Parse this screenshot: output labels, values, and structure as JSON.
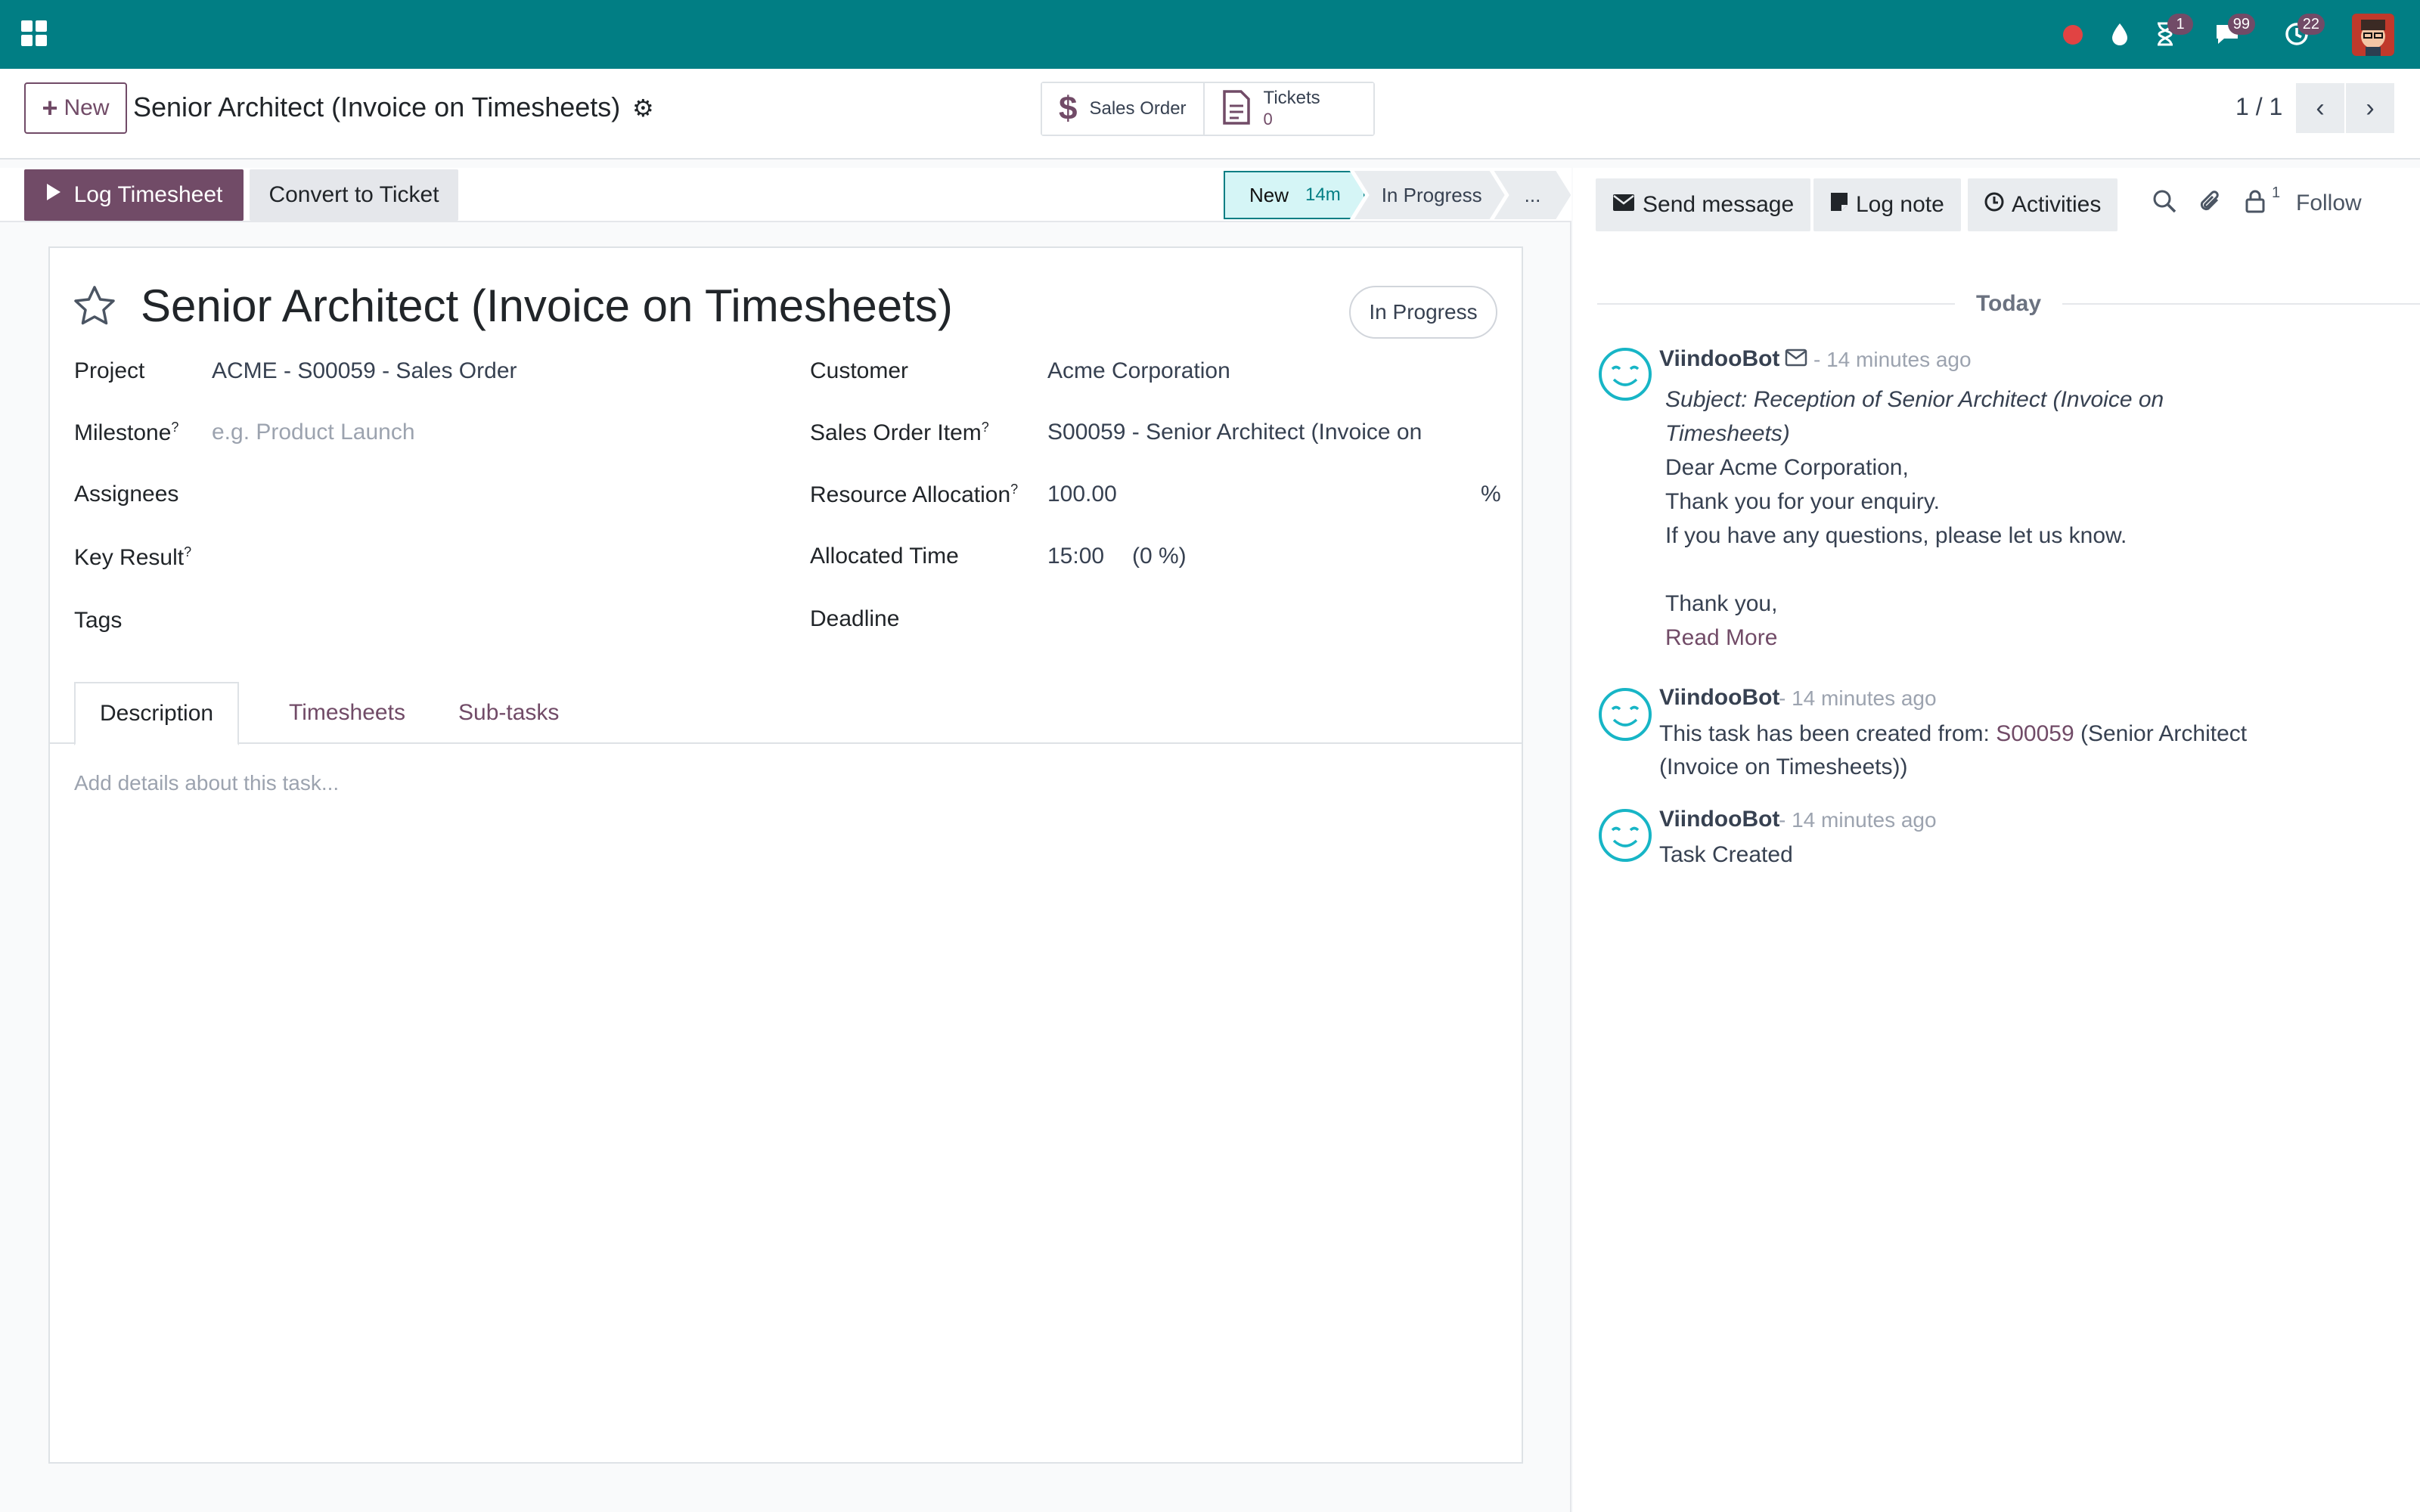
{
  "navbar": {
    "badges": {
      "activities": "1",
      "messages": "99",
      "history": "22"
    },
    "colors": {
      "bar": "#017e84",
      "badge": "#714b67",
      "record": "#e14343"
    }
  },
  "control_panel": {
    "new_label": "New",
    "record_title": "Senior Architect (Invoice on Timesheets)",
    "smart_buttons": [
      {
        "icon": "dollar-icon",
        "label": "Sales Order"
      },
      {
        "icon": "document-icon",
        "label": "Tickets",
        "count": "0"
      }
    ],
    "pager": "1 / 1"
  },
  "statusbar": {
    "log_timesheet": "Log Timesheet",
    "convert_ticket": "Convert to Ticket",
    "stages": [
      {
        "name": "New",
        "time": "14m",
        "active": true
      },
      {
        "name": "In Progress",
        "active": false
      },
      {
        "name": "...",
        "active": false
      }
    ]
  },
  "form": {
    "title": "Senior Architect (Invoice on Timesheets)",
    "state": "In Progress",
    "fields": {
      "project_label": "Project",
      "project_value": "ACME - S00059 - Sales Order",
      "milestone_label": "Milestone",
      "milestone_placeholder": "e.g. Product Launch",
      "assignees_label": "Assignees",
      "key_result_label": "Key Result",
      "tags_label": "Tags",
      "customer_label": "Customer",
      "customer_value": "Acme Corporation",
      "so_item_label": "Sales Order Item",
      "so_item_value": "S00059 - Senior Architect (Invoice on",
      "resource_label": "Resource Allocation",
      "resource_value": "100.00",
      "resource_unit": "%",
      "allocated_label": "Allocated Time",
      "allocated_value": "15:00",
      "allocated_pct": "(0 %)",
      "deadline_label": "Deadline",
      "help_mark": "?"
    },
    "tabs": [
      "Description",
      "Timesheets",
      "Sub-tasks"
    ],
    "description_placeholder": "Add details about this task..."
  },
  "chatter": {
    "send_message": "Send message",
    "log_note": "Log note",
    "activities": "Activities",
    "followers_count": "1",
    "follow": "Follow",
    "date_separator": "Today",
    "messages": [
      {
        "author": "ViindooBot",
        "meta": "- 14 minutes ago",
        "subject": "Subject: Reception of Senior Architect (Invoice on Timesheets)",
        "lines": [
          "Dear Acme Corporation,",
          "Thank you for your enquiry.",
          "If you have any questions, please let us know.",
          "",
          "Thank you,"
        ],
        "read_more": "Read More"
      },
      {
        "author": "ViindooBot",
        "meta": "- 14 minutes ago",
        "prefix": "This task has been created from: ",
        "link": "S00059",
        "suffix": " (Senior Architect",
        "line2": "(Invoice on Timesheets))"
      },
      {
        "author": "ViindooBot",
        "meta": "- 14 minutes ago",
        "text": "Task Created"
      }
    ]
  }
}
